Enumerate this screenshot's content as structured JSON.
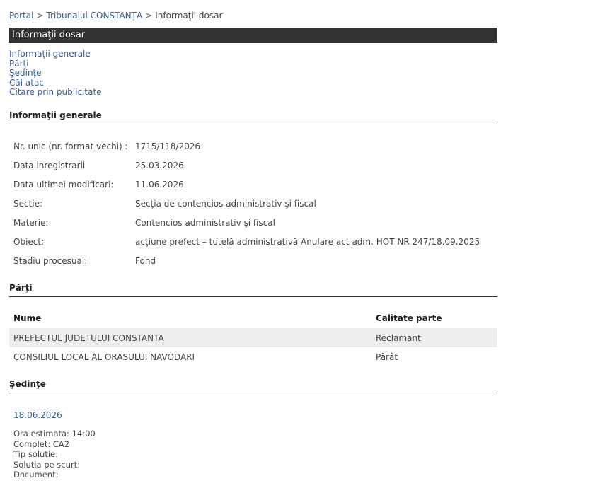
{
  "breadcrumb": {
    "portal": "Portal",
    "sep1": ">",
    "tribunal": "Tribunalul CONSTANŢA",
    "sep2": ">",
    "current": "Informaţii dosar"
  },
  "page_title": "Informaţii dosar",
  "nav": [
    "Informaţii generale",
    "Părţi",
    "Şedinţe",
    "Căi atac",
    "Citare prin publicitate"
  ],
  "general": {
    "header": "Informaţii generale",
    "rows": [
      {
        "label": "Nr. unic (nr. format vechi) :",
        "value": "1715/118/2026"
      },
      {
        "label": "Data inregistrarii",
        "value": "25.03.2026"
      },
      {
        "label": "Data ultimei modificari:",
        "value": "11.06.2026"
      },
      {
        "label": "Sectie:",
        "value": "Secţia de contencios administrativ şi fiscal"
      },
      {
        "label": "Materie:",
        "value": "Contencios administrativ şi fiscal"
      },
      {
        "label": "Obiect:",
        "value": "acţiune prefect – tutelă administrativă Anulare act adm. HOT NR 247/18.09.2025"
      },
      {
        "label": "Stadiu procesual:",
        "value": "Fond"
      }
    ]
  },
  "parti": {
    "header": "Părţi",
    "col_name": "Nume",
    "col_calitate": "Calitate parte",
    "rows": [
      {
        "nume": "PREFECTUL JUDETULUI CONSTANTA",
        "calitate": "Reclamant"
      },
      {
        "nume": "CONSILIUL LOCAL AL ORASULUI NAVODARI",
        "calitate": "Pârât"
      }
    ]
  },
  "sedinte": {
    "header": "Şedinţe",
    "date": "18.06.2026",
    "details": [
      "Ora estimata: 14:00",
      "Complet: CA2",
      "Tip solutie:",
      "Solutia pe scurt:",
      "Document:"
    ]
  }
}
